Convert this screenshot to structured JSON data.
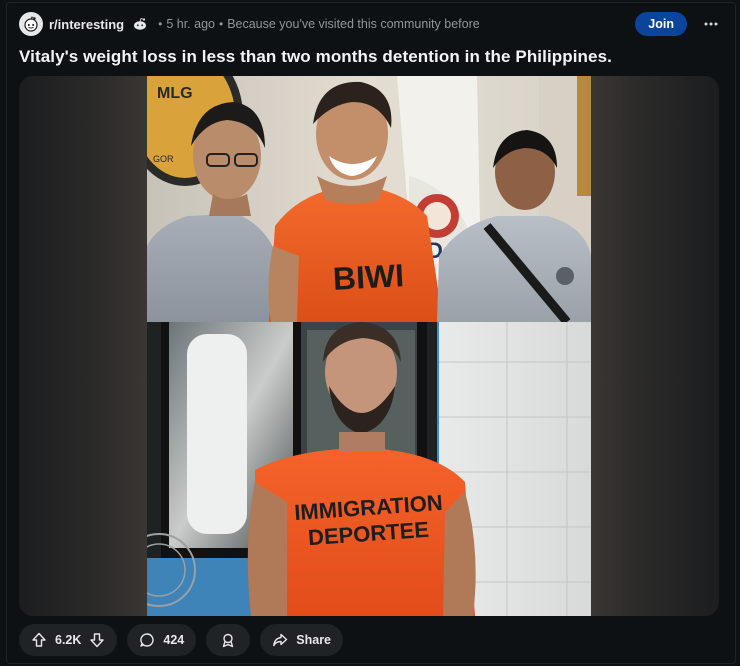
{
  "post": {
    "subreddit": "r/interesting",
    "time_ago": "5 hr. ago",
    "reason": "Because you've visited this community before",
    "join_label": "Join",
    "title": "Vitaly's weight loss in less than two months detention in the Philippines.",
    "image_text_top": "BIWI",
    "image_text_bottom_1": "IMMIGRATION",
    "image_text_bottom_2": "DEPORTEE"
  },
  "actions": {
    "upvotes": "6.2K",
    "comments": "424",
    "share_label": "Share"
  },
  "colors": {
    "join": "#0a449b",
    "background": "#0e1113",
    "pill": "#1f2326",
    "shirt_orange": "#f05a24"
  },
  "icons": [
    "reddit-avatar-icon",
    "moderator-snoo-icon",
    "more-options-icon",
    "upvote-icon",
    "downvote-icon",
    "comment-icon",
    "award-icon",
    "share-icon"
  ]
}
